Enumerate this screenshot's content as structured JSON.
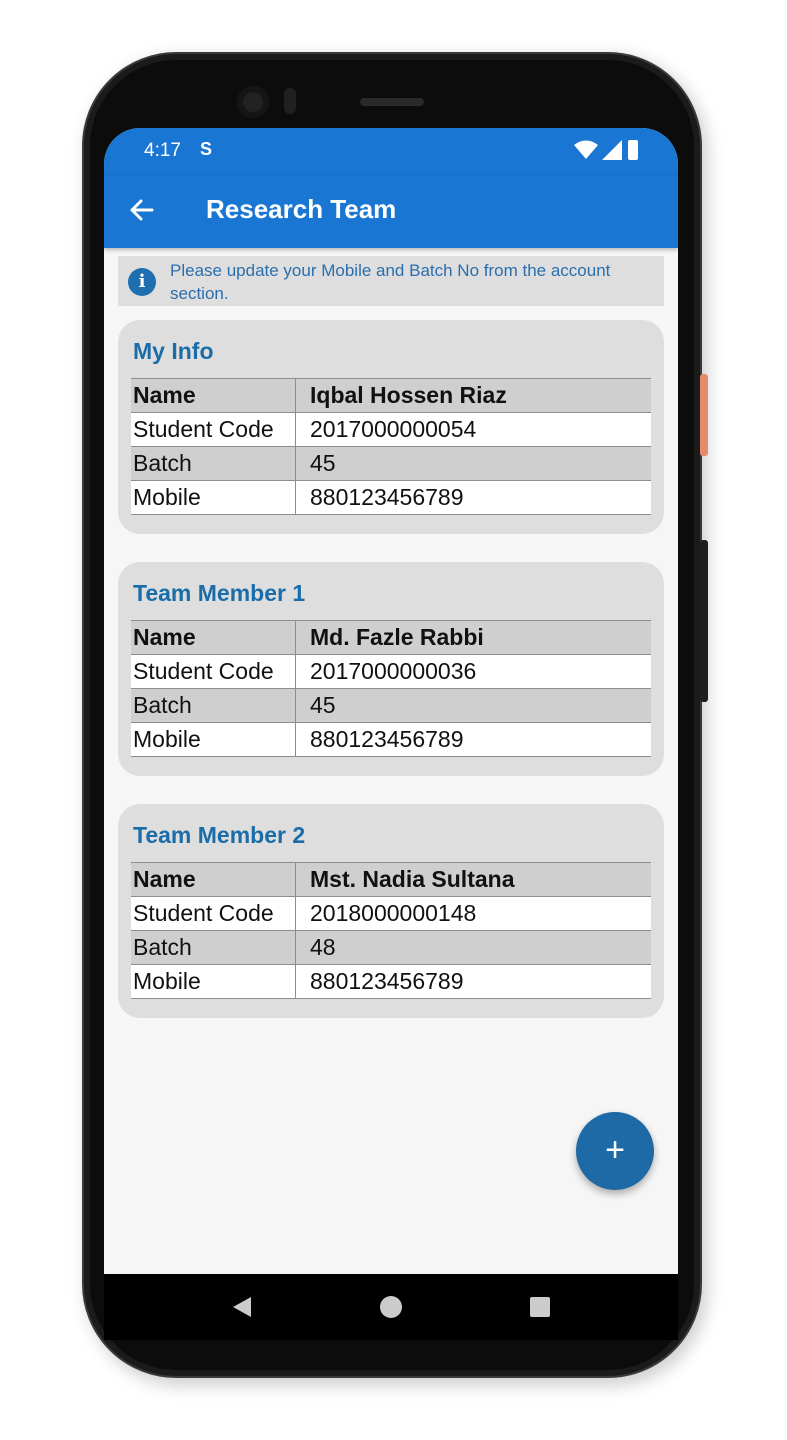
{
  "status_bar": {
    "time": "4:17",
    "sim_indicator": "S"
  },
  "app_bar": {
    "title": "Research Team",
    "back_icon": "arrow-left-icon"
  },
  "notice": {
    "icon": "info-icon",
    "icon_glyph": "i",
    "text": "Please update your Mobile and Batch No from the account section."
  },
  "cards": [
    {
      "title": "My Info",
      "rows": [
        {
          "label": "Name",
          "value": "Iqbal Hossen Riaz"
        },
        {
          "label": "Student Code",
          "value": "2017000000054"
        },
        {
          "label": "Batch",
          "value": "45"
        },
        {
          "label": "Mobile",
          "value": "880123456789"
        }
      ]
    },
    {
      "title": "Team Member 1",
      "rows": [
        {
          "label": "Name",
          "value": "Md. Fazle Rabbi"
        },
        {
          "label": "Student Code",
          "value": "2017000000036"
        },
        {
          "label": "Batch",
          "value": "45"
        },
        {
          "label": "Mobile",
          "value": "880123456789"
        }
      ]
    },
    {
      "title": "Team Member 2",
      "rows": [
        {
          "label": "Name",
          "value": "Mst. Nadia Sultana"
        },
        {
          "label": "Student Code",
          "value": "2018000000148"
        },
        {
          "label": "Batch",
          "value": "48"
        },
        {
          "label": "Mobile",
          "value": "880123456789"
        }
      ]
    }
  ],
  "fab": {
    "icon": "plus-icon",
    "glyph": "+"
  },
  "colors": {
    "primary": "#1976d2",
    "accent": "#1e6aa6",
    "title_text": "#1a6da8"
  }
}
